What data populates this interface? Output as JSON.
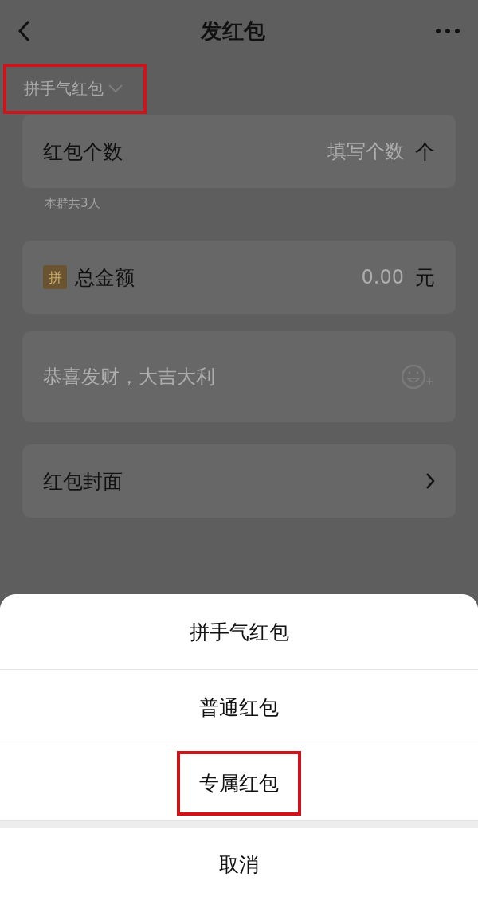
{
  "nav": {
    "title": "发红包"
  },
  "type_selector": {
    "label": "拼手气红包",
    "highlighted": true
  },
  "count_row": {
    "label": "红包个数",
    "placeholder": "填写个数",
    "unit": "个"
  },
  "count_hint": "本群共3人",
  "amount_row": {
    "badge": "拼",
    "label": "总金额",
    "placeholder": "0.00",
    "unit": "元"
  },
  "greeting": {
    "placeholder": "恭喜发财，大吉大利"
  },
  "cover_row": {
    "label": "红包封面"
  },
  "sheet": {
    "options": [
      {
        "label": "拼手气红包",
        "highlighted": false
      },
      {
        "label": "普通红包",
        "highlighted": false
      },
      {
        "label": "专属红包",
        "highlighted": true
      }
    ],
    "cancel": "取消"
  }
}
